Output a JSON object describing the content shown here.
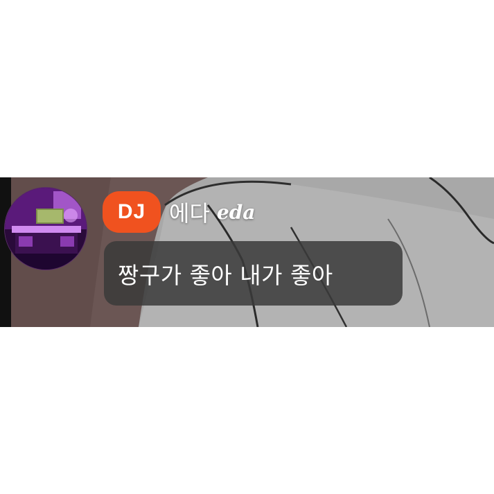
{
  "chat_message": {
    "badge_label": "DJ",
    "username": "에다",
    "username_script": "eda",
    "message_text": "짱구가 좋아 내가 좋아"
  },
  "colors": {
    "badge_bg": "#f0521f",
    "bubble_bg": "#3a3a3a",
    "avatar_tint": "#8a2bbf",
    "background": "#a9a9a9",
    "page": "#ffffff"
  },
  "icons": {
    "avatar": "user-avatar-purple-room"
  }
}
